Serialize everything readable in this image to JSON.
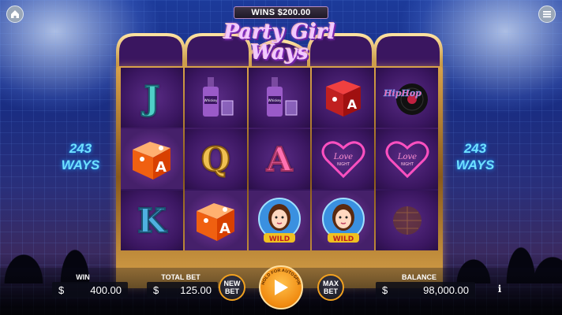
{
  "header": {
    "wins_text": "WINS $200.00",
    "title_line1": "Party Girl",
    "title_line2": "Ways"
  },
  "side": {
    "ways_left_line1": "243",
    "ways_left_line2": "WAYS",
    "ways_right_line1": "243",
    "ways_right_line2": "WAYS"
  },
  "reels": {
    "reel1": [
      "J",
      "dice",
      "K"
    ],
    "reel2": [
      "bottle",
      "Q",
      "dice"
    ],
    "reel3": [
      "bottle",
      "A",
      "wild"
    ],
    "reel4": [
      "dice",
      "heart",
      "wild"
    ],
    "reel5": [
      "vinyl",
      "heart",
      "disco"
    ],
    "dice_letter": "A",
    "heart_text_line1": "Love",
    "heart_text_line2": "NIGHT",
    "bottle_label": "Whiskey",
    "vinyl_label": "HipHop",
    "wild_label": "WILD"
  },
  "bottom": {
    "win_label": "WIN",
    "win_currency": "$",
    "win_value": "400.00",
    "bet_label": "TOTAL BET",
    "bet_currency": "$",
    "bet_value": "125.00",
    "new_bet_line1": "NEW",
    "new_bet_line2": "BET",
    "max_bet_line1": "MAX",
    "max_bet_line2": "BET",
    "hold_text": "HOLD FOR AUTOSPIN",
    "balance_label": "BALANCE",
    "balance_currency": "$",
    "balance_value": "98,000.00",
    "info_symbol": "i"
  },
  "icons": {
    "home": "home-icon",
    "menu": "menu-icon",
    "spin": "play-icon",
    "info": "info-icon"
  },
  "colors": {
    "accent_orange": "#f0a020",
    "frame_gold": "#d8a24a",
    "ways_cyan": "#6fe0ff",
    "reel_purple": "#3a1660"
  }
}
